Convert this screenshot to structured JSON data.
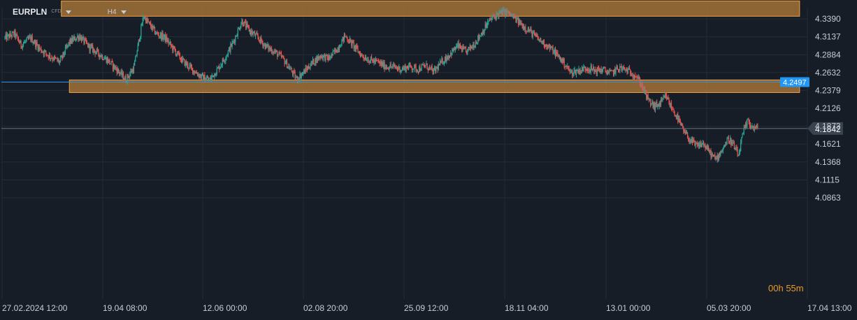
{
  "symbol": {
    "name": "EURPLN",
    "type": "CFD",
    "timeframe": "H4"
  },
  "countdown": {
    "hours": "00",
    "h_unit": "h",
    "minutes": "55",
    "m_unit": "m"
  },
  "colors": {
    "background": "#161d26",
    "grid": "#232c38",
    "up_candle": "#26a69a",
    "down_candle": "#ef5350",
    "zone_fill": "#b07a3a",
    "zone_border": "#f0a040",
    "blue_line": "#2196f3",
    "price_line": "#6b7480",
    "current_label": "#3a4350"
  },
  "chart_data": {
    "type": "candlestick",
    "ylim": [
      4.0863,
      4.3643
    ],
    "y_ticks": [
      "4.3390",
      "4.3137",
      "4.2884",
      "4.2632",
      "4.2379",
      "4.2126",
      "4.1873",
      "4.1621",
      "4.1368",
      "4.1115",
      "4.0863"
    ],
    "x_ticks": [
      "27.02.2024 12:00",
      "19.04 08:00",
      "12.06 00:00",
      "02.08 20:00",
      "25.09 12:00",
      "18.11 04:00",
      "13.01 00:00",
      "05.03 20:00",
      "17.04 13:00"
    ],
    "grid": true,
    "price_path_anchors": [
      [
        0,
        4.312
      ],
      [
        6,
        4.318
      ],
      [
        10,
        4.302
      ],
      [
        16,
        4.312
      ],
      [
        22,
        4.296
      ],
      [
        28,
        4.286
      ],
      [
        34,
        4.278
      ],
      [
        40,
        4.306
      ],
      [
        46,
        4.315
      ],
      [
        52,
        4.3
      ],
      [
        58,
        4.29
      ],
      [
        64,
        4.28
      ],
      [
        70,
        4.266
      ],
      [
        75,
        4.253
      ],
      [
        80,
        4.27
      ],
      [
        86,
        4.343
      ],
      [
        90,
        4.33
      ],
      [
        94,
        4.318
      ],
      [
        99,
        4.313
      ],
      [
        104,
        4.298
      ],
      [
        110,
        4.28
      ],
      [
        116,
        4.268
      ],
      [
        122,
        4.257
      ],
      [
        127,
        4.253
      ],
      [
        132,
        4.268
      ],
      [
        137,
        4.286
      ],
      [
        142,
        4.308
      ],
      [
        147,
        4.336
      ],
      [
        152,
        4.322
      ],
      [
        157,
        4.312
      ],
      [
        162,
        4.3
      ],
      [
        167,
        4.293
      ],
      [
        172,
        4.284
      ],
      [
        177,
        4.268
      ],
      [
        181,
        4.254
      ],
      [
        186,
        4.265
      ],
      [
        191,
        4.278
      ],
      [
        196,
        4.287
      ],
      [
        201,
        4.283
      ],
      [
        206,
        4.296
      ],
      [
        211,
        4.315
      ],
      [
        216,
        4.302
      ],
      [
        221,
        4.288
      ],
      [
        226,
        4.281
      ],
      [
        231,
        4.278
      ],
      [
        236,
        4.272
      ],
      [
        241,
        4.271
      ],
      [
        246,
        4.268
      ],
      [
        251,
        4.272
      ],
      [
        256,
        4.268
      ],
      [
        261,
        4.273
      ],
      [
        266,
        4.264
      ],
      [
        271,
        4.278
      ],
      [
        276,
        4.289
      ],
      [
        281,
        4.301
      ],
      [
        286,
        4.292
      ],
      [
        291,
        4.303
      ],
      [
        296,
        4.32
      ],
      [
        301,
        4.338
      ],
      [
        306,
        4.346
      ],
      [
        311,
        4.349
      ],
      [
        316,
        4.34
      ],
      [
        321,
        4.33
      ],
      [
        326,
        4.321
      ],
      [
        331,
        4.31
      ],
      [
        336,
        4.302
      ],
      [
        341,
        4.292
      ],
      [
        346,
        4.279
      ],
      [
        351,
        4.263
      ],
      [
        356,
        4.266
      ],
      [
        361,
        4.27
      ],
      [
        366,
        4.266
      ],
      [
        371,
        4.267
      ],
      [
        376,
        4.262
      ],
      [
        381,
        4.27
      ],
      [
        386,
        4.266
      ],
      [
        391,
        4.26
      ],
      [
        395,
        4.246
      ],
      [
        399,
        4.224
      ],
      [
        403,
        4.215
      ],
      [
        407,
        4.22
      ],
      [
        410,
        4.23
      ],
      [
        413,
        4.216
      ],
      [
        417,
        4.2
      ],
      [
        421,
        4.18
      ],
      [
        425,
        4.168
      ],
      [
        429,
        4.159
      ],
      [
        433,
        4.163
      ],
      [
        437,
        4.151
      ],
      [
        441,
        4.14
      ],
      [
        445,
        4.155
      ],
      [
        449,
        4.17
      ],
      [
        452,
        4.16
      ],
      [
        455,
        4.145
      ],
      [
        458,
        4.178
      ],
      [
        461,
        4.195
      ],
      [
        464,
        4.185
      ],
      [
        467,
        4.184
      ]
    ],
    "current_price": "4.1842",
    "current_price_value": 4.1842,
    "blue_line_price": "4.2497",
    "blue_line_value": 4.2497,
    "zones": [
      {
        "name": "resistance-zone",
        "low": 4.3427,
        "high": 4.3643,
        "t_start": 35,
        "t_end": 493
      },
      {
        "name": "support-zone",
        "low": 4.2349,
        "high": 4.2527,
        "t_start": 40,
        "t_end": 493
      }
    ]
  }
}
